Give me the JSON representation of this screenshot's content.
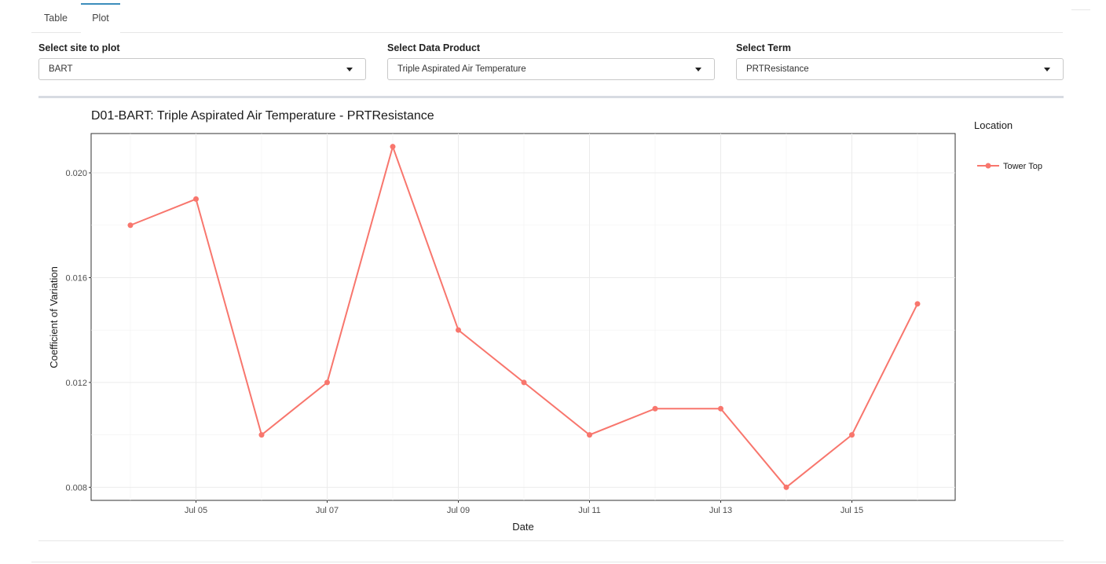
{
  "tabs": [
    {
      "label": "Table",
      "active": false
    },
    {
      "label": "Plot",
      "active": true
    }
  ],
  "filters": {
    "site": {
      "label": "Select site to plot",
      "value": "BART"
    },
    "product": {
      "label": "Select Data Product",
      "value": "Triple Aspirated Air Temperature"
    },
    "term": {
      "label": "Select Term",
      "value": "PRTResistance"
    }
  },
  "chart_data": {
    "type": "line",
    "title": "D01-BART: Triple Aspirated Air Temperature - PRTResistance",
    "xlabel": "Date",
    "ylabel": "Coefficient of Variation",
    "x": [
      "Jul 04",
      "Jul 05",
      "Jul 06",
      "Jul 07",
      "Jul 08",
      "Jul 09",
      "Jul 10",
      "Jul 11",
      "Jul 12",
      "Jul 13",
      "Jul 14",
      "Jul 15",
      "Jul 16"
    ],
    "xticks": [
      "Jul 05",
      "Jul 07",
      "Jul 09",
      "Jul 11",
      "Jul 13",
      "Jul 15"
    ],
    "yticks": [
      "0.008",
      "0.012",
      "0.016",
      "0.020"
    ],
    "ylim": [
      0.0075,
      0.0215
    ],
    "grid": true,
    "legend": {
      "title": "Location",
      "placement": "right"
    },
    "series": [
      {
        "name": "Tower Top",
        "color": "#f8766d",
        "values": [
          0.018,
          0.019,
          0.01,
          0.012,
          0.021,
          0.014,
          0.012,
          0.01,
          0.011,
          0.011,
          0.008,
          0.01,
          0.015
        ]
      }
    ]
  }
}
